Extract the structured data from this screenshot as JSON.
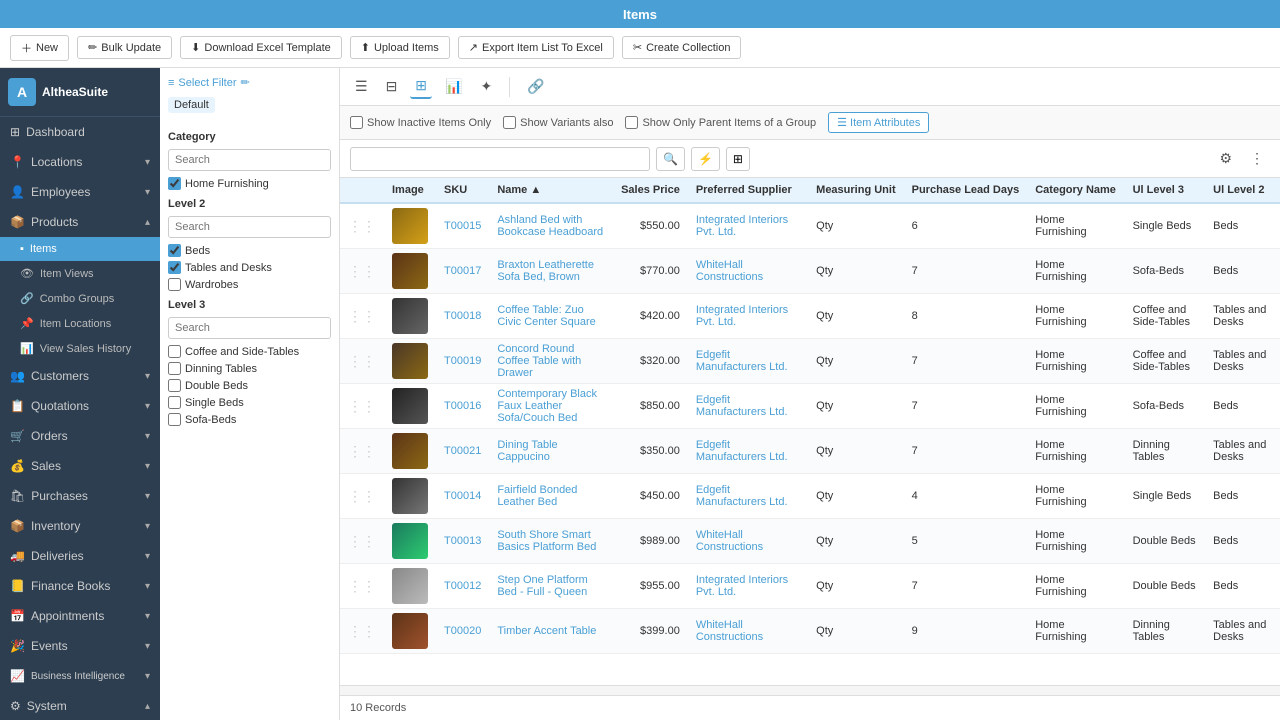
{
  "topbar": {
    "title": "Items"
  },
  "actionbar": {
    "new_label": "New",
    "bulk_update_label": "Bulk Update",
    "download_excel_label": "Download Excel Template",
    "upload_items_label": "Upload Items",
    "export_label": "Export Item List To Excel",
    "create_collection_label": "Create Collection"
  },
  "sidebar": {
    "logo_text": "AltheaSuite",
    "items": [
      {
        "id": "dashboard",
        "label": "Dashboard",
        "icon": "⊞",
        "has_chevron": false
      },
      {
        "id": "locations",
        "label": "Locations",
        "icon": "📍",
        "has_chevron": true
      },
      {
        "id": "employees",
        "label": "Employees",
        "icon": "👤",
        "has_chevron": true
      },
      {
        "id": "products",
        "label": "Products",
        "icon": "📦",
        "has_chevron": true,
        "expanded": true
      },
      {
        "id": "items",
        "label": "Items",
        "icon": "▪",
        "is_sub": true,
        "active": true
      },
      {
        "id": "item-views",
        "label": "Item Views",
        "icon": "👁",
        "is_sub": true
      },
      {
        "id": "combo-groups",
        "label": "Combo Groups",
        "icon": "🔗",
        "is_sub": true
      },
      {
        "id": "item-locations",
        "label": "Item Locations",
        "icon": "📌",
        "is_sub": true
      },
      {
        "id": "view-sales-history",
        "label": "View Sales History",
        "icon": "📊",
        "is_sub": true
      },
      {
        "id": "customers",
        "label": "Customers",
        "icon": "👥",
        "has_chevron": true
      },
      {
        "id": "quotations",
        "label": "Quotations",
        "icon": "📋",
        "has_chevron": true
      },
      {
        "id": "orders",
        "label": "Orders",
        "icon": "🛒",
        "has_chevron": true
      },
      {
        "id": "sales",
        "label": "Sales",
        "icon": "💰",
        "has_chevron": true
      },
      {
        "id": "purchases",
        "label": "Purchases",
        "icon": "🛍",
        "has_chevron": true
      },
      {
        "id": "inventory",
        "label": "Inventory",
        "icon": "📦",
        "has_chevron": true
      },
      {
        "id": "deliveries",
        "label": "Deliveries",
        "icon": "🚚",
        "has_chevron": true
      },
      {
        "id": "finance-books",
        "label": "Finance Books",
        "icon": "📒",
        "has_chevron": true
      },
      {
        "id": "appointments",
        "label": "Appointments",
        "icon": "📅",
        "has_chevron": true
      },
      {
        "id": "events",
        "label": "Events",
        "icon": "🎉",
        "has_chevron": true
      },
      {
        "id": "business-intelligence",
        "label": "Business Intelligence",
        "icon": "📈",
        "has_chevron": true
      },
      {
        "id": "system",
        "label": "System",
        "icon": "⚙",
        "has_chevron": true
      }
    ]
  },
  "filter": {
    "select_filter_label": "Select Filter",
    "default_label": "Default",
    "category_label": "Category",
    "category_search_placeholder": "Search",
    "category_items": [
      {
        "label": "Home Furnishing",
        "checked": true
      }
    ],
    "level2_label": "Level 2",
    "level2_search_placeholder": "Search",
    "level2_items": [
      {
        "label": "Beds",
        "checked": true
      },
      {
        "label": "Tables and Desks",
        "checked": true
      },
      {
        "label": "Wardrobes",
        "checked": false
      }
    ],
    "level3_label": "Level 3",
    "level3_search_placeholder": "Search",
    "level3_items": [
      {
        "label": "Coffee and Side-Tables",
        "checked": false
      },
      {
        "label": "Dinning Tables",
        "checked": false
      },
      {
        "label": "Double Beds",
        "checked": false
      },
      {
        "label": "Single Beds",
        "checked": false
      },
      {
        "label": "Sofa-Beds",
        "checked": false
      }
    ]
  },
  "content": {
    "filter_bar": {
      "show_inactive_label": "Show Inactive Items Only",
      "show_variants_label": "Show Variants also",
      "show_parent_label": "Show Only Parent Items of a Group",
      "item_attributes_label": "Item Attributes"
    },
    "search_placeholder": "",
    "records_count": "10 Records",
    "columns": [
      {
        "id": "image",
        "label": "Image"
      },
      {
        "id": "sku",
        "label": "SKU"
      },
      {
        "id": "name",
        "label": "Name ▲"
      },
      {
        "id": "sales_price",
        "label": "Sales Price"
      },
      {
        "id": "preferred_supplier",
        "label": "Preferred Supplier"
      },
      {
        "id": "measuring_unit",
        "label": "Measuring Unit"
      },
      {
        "id": "purchase_lead_days",
        "label": "Purchase Lead Days"
      },
      {
        "id": "category_name",
        "label": "Category Name"
      },
      {
        "id": "ui_level3",
        "label": "Ul Level 3"
      },
      {
        "id": "ui_level2",
        "label": "Ul Level 2"
      }
    ],
    "rows": [
      {
        "sku": "T00015",
        "name": "Ashland Bed with Bookcase Headboard",
        "sales_price": "$550.00",
        "preferred_supplier": "Integrated Interiors Pvt. Ltd.",
        "measuring_unit": "Qty",
        "purchase_lead_days": "6",
        "category_name": "Home Furnishing",
        "ui_level3": "Single Beds",
        "ui_level2": "Beds",
        "img_class": "img-bed"
      },
      {
        "sku": "T00017",
        "name": "Braxton Leatherette Sofa Bed, Brown",
        "sales_price": "$770.00",
        "preferred_supplier": "WhiteHall Constructions",
        "measuring_unit": "Qty",
        "purchase_lead_days": "7",
        "category_name": "Home Furnishing",
        "ui_level3": "Sofa-Beds",
        "ui_level2": "Beds",
        "img_class": "img-sofa"
      },
      {
        "sku": "T00018",
        "name": "Coffee Table: Zuo Civic Center Square",
        "sales_price": "$420.00",
        "preferred_supplier": "Integrated Interiors Pvt. Ltd.",
        "measuring_unit": "Qty",
        "purchase_lead_days": "8",
        "category_name": "Home Furnishing",
        "ui_level3": "Coffee and Side-Tables",
        "ui_level2": "Tables and Desks",
        "img_class": "img-coffee"
      },
      {
        "sku": "T00019",
        "name": "Concord Round Coffee Table with Drawer",
        "sales_price": "$320.00",
        "preferred_supplier": "Edgefit Manufacturers Ltd.",
        "measuring_unit": "Qty",
        "purchase_lead_days": "7",
        "category_name": "Home Furnishing",
        "ui_level3": "Coffee and Side-Tables",
        "ui_level2": "Tables and Desks",
        "img_class": "img-concord"
      },
      {
        "sku": "T00016",
        "name": "Contemporary Black Faux Leather Sofa/Couch Bed",
        "sales_price": "$850.00",
        "preferred_supplier": "Edgefit Manufacturers Ltd.",
        "measuring_unit": "Qty",
        "purchase_lead_days": "7",
        "category_name": "Home Furnishing",
        "ui_level3": "Sofa-Beds",
        "ui_level2": "Beds",
        "img_class": "img-contemporary"
      },
      {
        "sku": "T00021",
        "name": "Dining Table Cappucino",
        "sales_price": "$350.00",
        "preferred_supplier": "Edgefit Manufacturers Ltd.",
        "measuring_unit": "Qty",
        "purchase_lead_days": "7",
        "category_name": "Home Furnishing",
        "ui_level3": "Dinning Tables",
        "ui_level2": "Tables and Desks",
        "img_class": "img-dining"
      },
      {
        "sku": "T00014",
        "name": "Fairfield Bonded Leather Bed",
        "sales_price": "$450.00",
        "preferred_supplier": "Edgefit Manufacturers Ltd.",
        "measuring_unit": "Qty",
        "purchase_lead_days": "4",
        "category_name": "Home Furnishing",
        "ui_level3": "Single Beds",
        "ui_level2": "Beds",
        "img_class": "img-fairfield"
      },
      {
        "sku": "T00013",
        "name": "South Shore Smart Basics Platform Bed",
        "sales_price": "$989.00",
        "preferred_supplier": "WhiteHall Constructions",
        "measuring_unit": "Qty",
        "purchase_lead_days": "5",
        "category_name": "Home Furnishing",
        "ui_level3": "Double Beds",
        "ui_level2": "Beds",
        "img_class": "img-south"
      },
      {
        "sku": "T00012",
        "name": "Step One Platform Bed - Full - Queen",
        "sales_price": "$955.00",
        "preferred_supplier": "Integrated Interiors Pvt. Ltd.",
        "measuring_unit": "Qty",
        "purchase_lead_days": "7",
        "category_name": "Home Furnishing",
        "ui_level3": "Double Beds",
        "ui_level2": "Beds",
        "img_class": "img-step"
      },
      {
        "sku": "T00020",
        "name": "Timber Accent Table",
        "sales_price": "$399.00",
        "preferred_supplier": "WhiteHall Constructions",
        "measuring_unit": "Qty",
        "purchase_lead_days": "9",
        "category_name": "Home Furnishing",
        "ui_level3": "Dinning Tables",
        "ui_level2": "Tables and Desks",
        "img_class": "img-timber"
      }
    ]
  }
}
